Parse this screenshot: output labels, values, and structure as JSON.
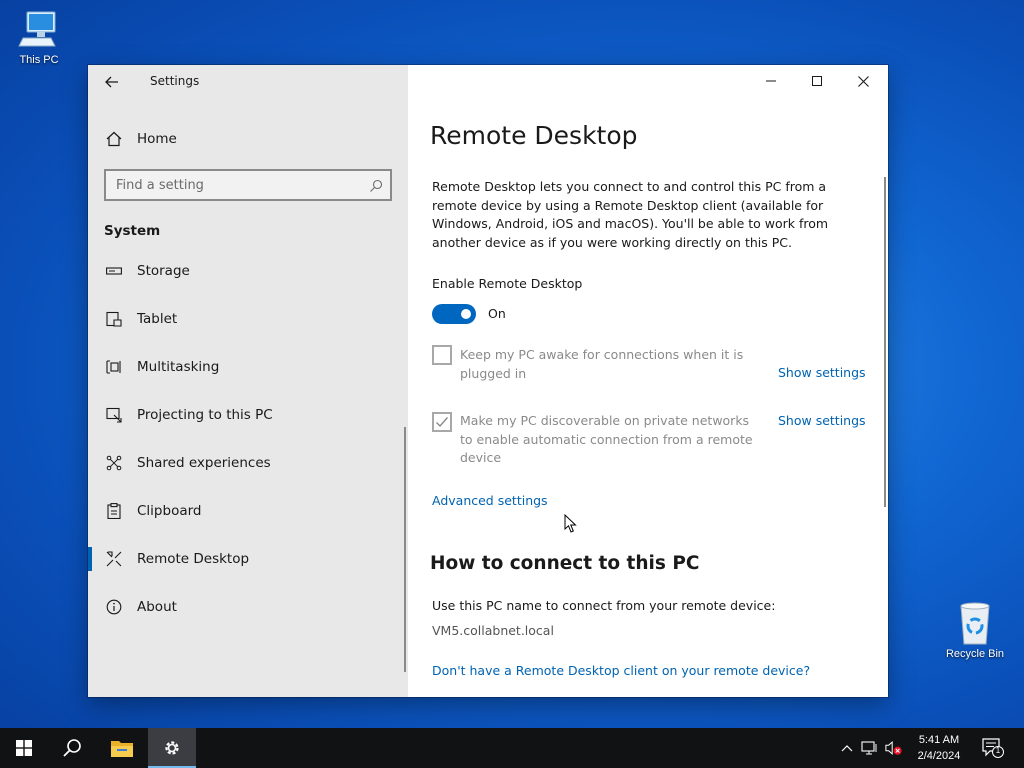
{
  "desktop": {
    "this_pc": "This PC",
    "recycle_bin": "Recycle Bin"
  },
  "window": {
    "app_title": "Settings"
  },
  "sidebar": {
    "home": "Home",
    "search_placeholder": "Find a setting",
    "section": "System",
    "items": [
      {
        "label": "Storage",
        "icon": "storage-icon"
      },
      {
        "label": "Tablet",
        "icon": "tablet-icon"
      },
      {
        "label": "Multitasking",
        "icon": "multitasking-icon"
      },
      {
        "label": "Projecting to this PC",
        "icon": "projecting-icon"
      },
      {
        "label": "Shared experiences",
        "icon": "shared-experiences-icon"
      },
      {
        "label": "Clipboard",
        "icon": "clipboard-icon"
      },
      {
        "label": "Remote Desktop",
        "icon": "remote-desktop-icon",
        "selected": true
      },
      {
        "label": "About",
        "icon": "info-icon"
      }
    ]
  },
  "content": {
    "title": "Remote Desktop",
    "description": "Remote Desktop lets you connect to and control this PC from a remote device by using a Remote Desktop client (available for Windows, Android, iOS and macOS). You'll be able to work from another device as if you were working directly on this PC.",
    "enable_label": "Enable Remote Desktop",
    "toggle_state": "On",
    "keep_awake": "Keep my PC awake for connections when it is plugged in",
    "discoverable": "Make my PC discoverable on private networks to enable automatic connection from a remote device",
    "show_settings": "Show settings",
    "advanced": "Advanced settings",
    "how_to_title": "How to connect to this PC",
    "pc_name_label": "Use this PC name to connect from your remote device:",
    "pc_name": "VM5.collabnet.local",
    "no_client_link": "Don't have a Remote Desktop client on your remote device?"
  },
  "taskbar": {
    "time": "5:41 AM",
    "date": "2/4/2024",
    "notification_count": "1"
  },
  "colors": {
    "accent": "#0067c0",
    "link": "#0063b1",
    "sidebar_bg": "#e8e8e8",
    "taskbar_bg": "#111214"
  }
}
